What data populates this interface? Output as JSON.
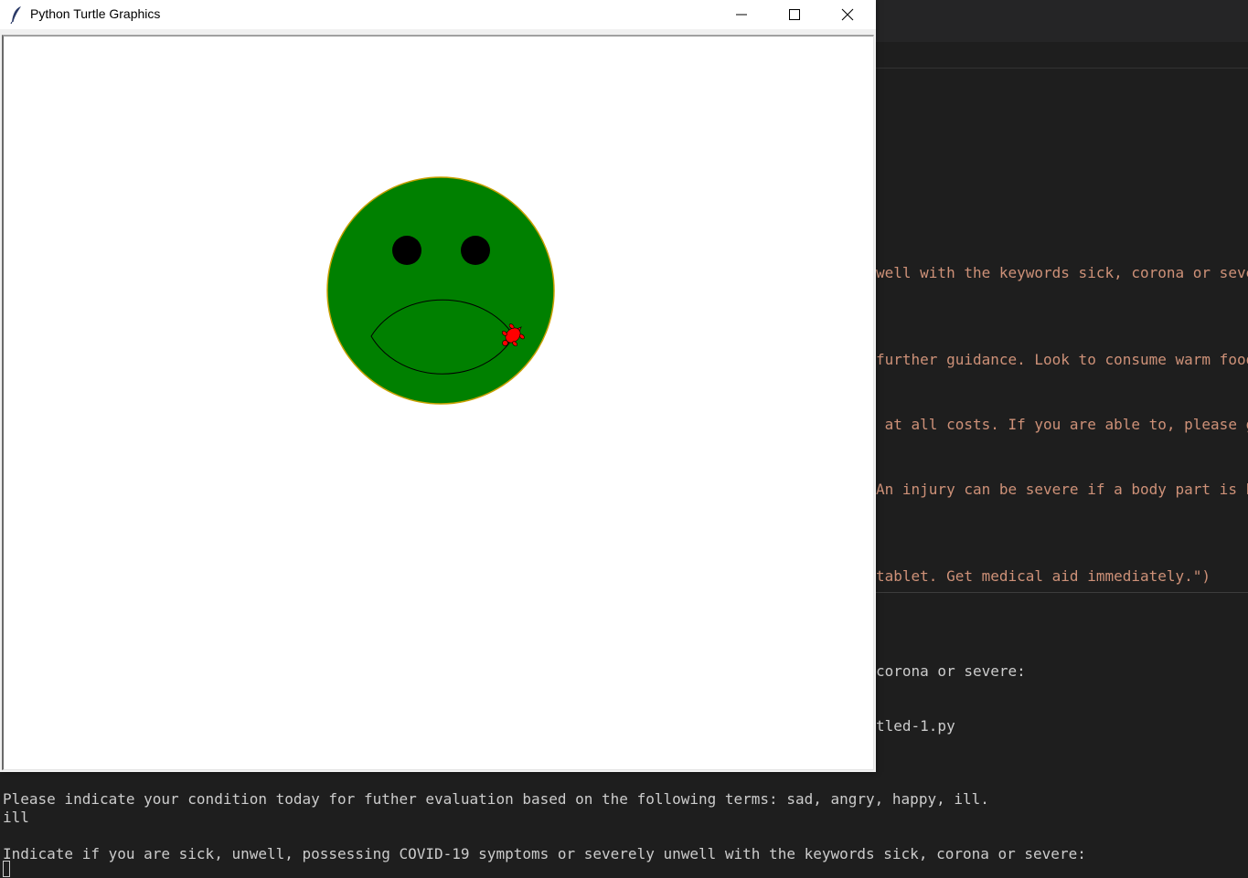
{
  "window": {
    "title": "Python Turtle Graphics",
    "icon": "feather-icon",
    "controls": [
      "minimize-icon",
      "maximize-icon",
      "close-icon"
    ]
  },
  "drawing": {
    "face_color": "#008000",
    "outline_color": "#c8a000",
    "eye_color": "#000000",
    "turtle_color": "#ff0000"
  },
  "editor": {
    "lines": [
      "well with the keywords sick, corona or seve",
      "further guidance. Look to consume warm food",
      " at all costs. If you are able to, please g",
      "An injury can be severe if a body part is b",
      "tablet. Get medical aid immediately.\")"
    ],
    "string_color": "#ce9178"
  },
  "terminal": {
    "partial_lines": [
      "corona or severe:",
      "tled-1.py"
    ],
    "lines": [
      "Please indicate your condition today for futher evaluation based on the following terms: sad, angry, happy, ill.",
      "ill",
      "",
      "Indicate if you are sick, unwell, possessing COVID-19 symptoms or severely unwell with the keywords sick, corona or severe:"
    ]
  }
}
